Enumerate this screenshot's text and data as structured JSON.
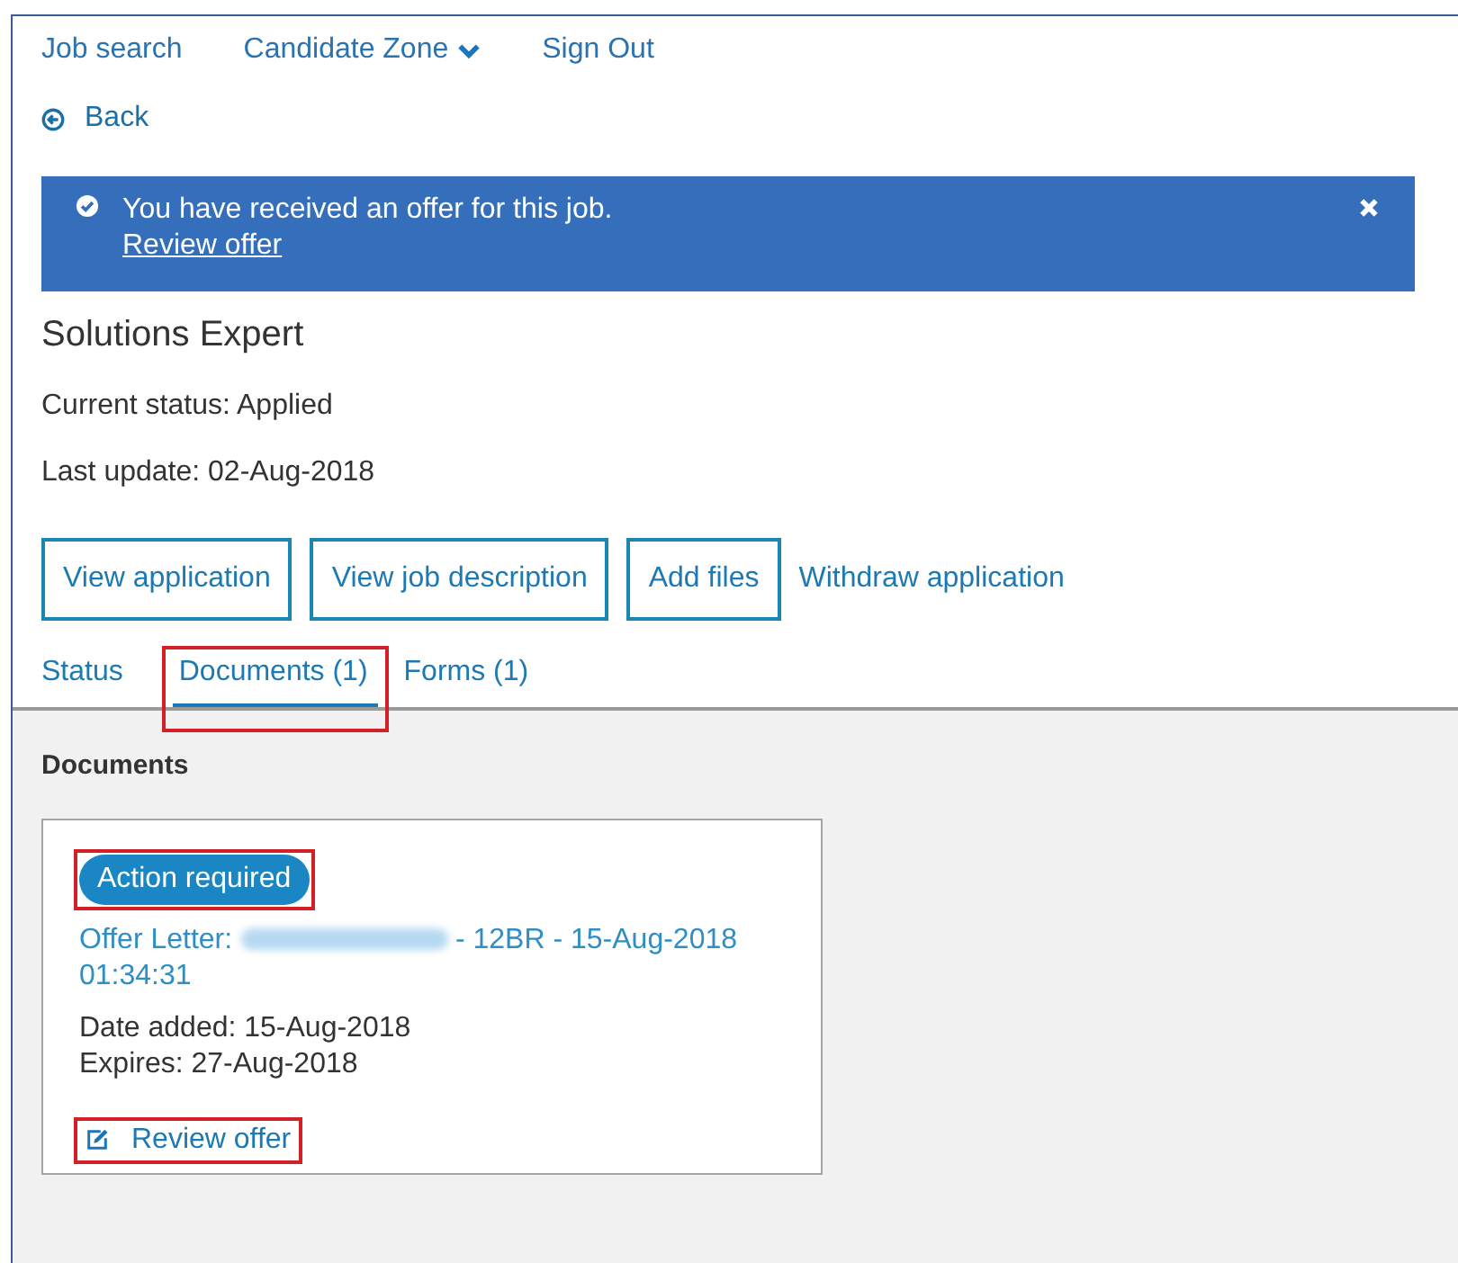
{
  "nav": [
    {
      "label": "Job search",
      "dropdown": false
    },
    {
      "label": "Candidate Zone",
      "dropdown": true
    },
    {
      "label": "Sign Out",
      "dropdown": false
    }
  ],
  "back": {
    "label": "Back"
  },
  "alert": {
    "message": "You have received an offer for this job.",
    "link": "Review offer"
  },
  "job": {
    "title": "Solutions Expert",
    "status": "Current status: Applied",
    "updated": "Last update: 02-Aug-2018"
  },
  "actions": [
    {
      "label": "View application",
      "kind": "outlined"
    },
    {
      "label": "View job description",
      "kind": "outlined"
    },
    {
      "label": "Add files",
      "kind": "outlined"
    },
    {
      "label": "Withdraw application",
      "kind": "link"
    }
  ],
  "tabs": [
    {
      "label": "Status",
      "selected": false,
      "highlighted": false
    },
    {
      "label": "Documents (1)",
      "selected": true,
      "highlighted": true
    },
    {
      "label": "Forms (1)",
      "selected": false,
      "highlighted": false
    }
  ],
  "section": {
    "title": "Documents"
  },
  "documents": [
    {
      "badge": "Action required",
      "badge_highlighted": true,
      "link_prefix": "Offer Letter:",
      "redacted": true,
      "link_suffix": "- 12BR - 15-Aug-2018 01:34:31",
      "date_added": "Date added: 15-Aug-2018",
      "expires": "Expires: 27-Aug-2018",
      "action": "Review offer",
      "action_highlighted": true
    }
  ]
}
